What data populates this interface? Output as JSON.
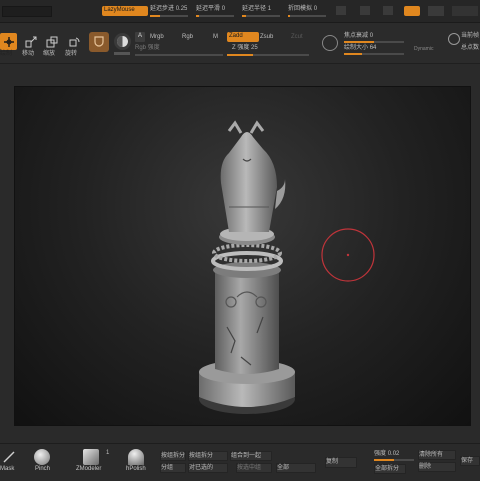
{
  "top": {
    "lazymouse": "LazyMouse",
    "lazy_step_label": "延迟步进",
    "lazy_step_value": "0.25",
    "lazy_smooth_label": "延迟平滑",
    "lazy_smooth_value": "0",
    "lazy_radius_label": "延迟半径",
    "lazy_radius_value": "1",
    "backtrack_label": "折回模拟",
    "backtrack_value": "0"
  },
  "tools": {
    "draw": "绘制",
    "move": "移动",
    "scale": "缩放",
    "rotate": "旋转"
  },
  "brush": {
    "a": "A",
    "mrgb": "Mrgb",
    "rgb": "Rgb",
    "m": "M",
    "zadd": "Zadd",
    "zsub": "Zsub",
    "rgb_intensity_label": "Rgb 强度",
    "z_intensity_label": "Z 强度",
    "z_intensity_value": "25",
    "focal_label": "焦点衰减",
    "focal_value": "0",
    "draw_size_label": "绘制大小",
    "draw_size_value": "64",
    "dynamic": "Dynamic",
    "right_1": "当前帧",
    "right_2": "总点数"
  },
  "bottom": {
    "mask_label": "Mask",
    "pinch_label": "Pinch",
    "zmodeler_label": "ZModeler",
    "zmodeler_badge": "1",
    "hpolish_label": "hPolish",
    "btn_1": "按组拆分",
    "btn_2": "按组拆分",
    "btn_3": "组合到一起",
    "btn_4": "对已选的",
    "btn_5": "按选中组",
    "btn_6": "分组",
    "btn_7": "全部",
    "btn_8": "复制",
    "btn_9": "全部拆分",
    "strength_label": "强度",
    "strength_value": "0.02",
    "right_btn_1": "清除所有",
    "right_btn_2": "删除",
    "right_btn_3": "保存"
  },
  "colors": {
    "accent": "#e0871f",
    "cursor_ring": "#c0343a"
  }
}
